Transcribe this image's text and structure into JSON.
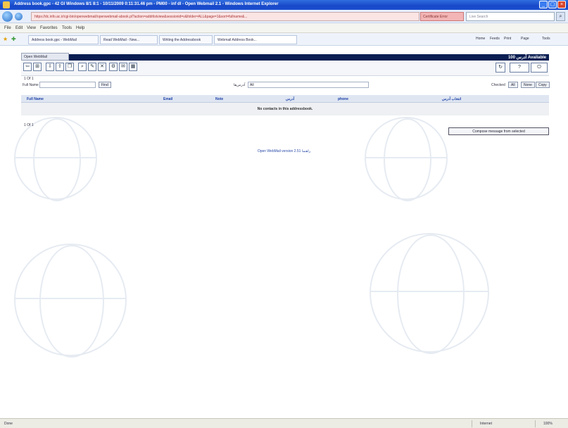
{
  "window": {
    "title": "Address book.gpc - 42 Gl Windows 8/1 8:1 - 10/11/2009 0:11:31.46 pm - PM00 - inf dl - Open Webmail 2.1 - Windows Internet Explorer"
  },
  "addressbar": {
    "url": "https://dc.info.ac.ir/cgi-bin/openwebmail/openwebmail-abook.pl?action=addrlistview&sessionid=v&folder=ALL&page=1&sort=fullname&...",
    "cert_label": "Certificate Error",
    "search_placeholder": "Live Search"
  },
  "menubar": {
    "items": [
      "File",
      "Edit",
      "View",
      "Favorites",
      "Tools",
      "Help"
    ]
  },
  "favbar": {
    "tabs": [
      "Address book.gpc - WebMail",
      "Read WebMail - New...",
      "Writing the Addressbook",
      "Webmail Address Book..."
    ],
    "commands": [
      "Home",
      "Feeds",
      "Print",
      "Page",
      "Tools"
    ]
  },
  "app": {
    "tab_label": "Open WebMail",
    "available": "100 آدرس Available"
  },
  "toolbar": {
    "buttons": [
      "back",
      "new-folder",
      "import",
      "export",
      "copy",
      "search",
      "edit",
      "delete",
      "config",
      "mail"
    ]
  },
  "pager": {
    "top": "1 Of 1",
    "bottom": "1 Of 1"
  },
  "filter": {
    "fullname_label": "Full Name",
    "fullname_value": "",
    "search_button": "Find",
    "folder_label": "آدرس‌ها",
    "folder_value": "All",
    "checkbox_label": "Checked",
    "select_all": "All",
    "none": "None",
    "copy": "Copy"
  },
  "table": {
    "headers": [
      "Full Name",
      "Email",
      "Note",
      "آدرس",
      "phone",
      "انتخاب آدرس"
    ],
    "empty_message": "No contacts in this addressbook."
  },
  "actions": {
    "unlock": "Compose message from selected"
  },
  "footer": {
    "version": "Open WebMail version 2.51",
    "help": "راهنما"
  },
  "statusbar": {
    "left": "Done",
    "zone": "Internet",
    "zoom": "100%"
  }
}
